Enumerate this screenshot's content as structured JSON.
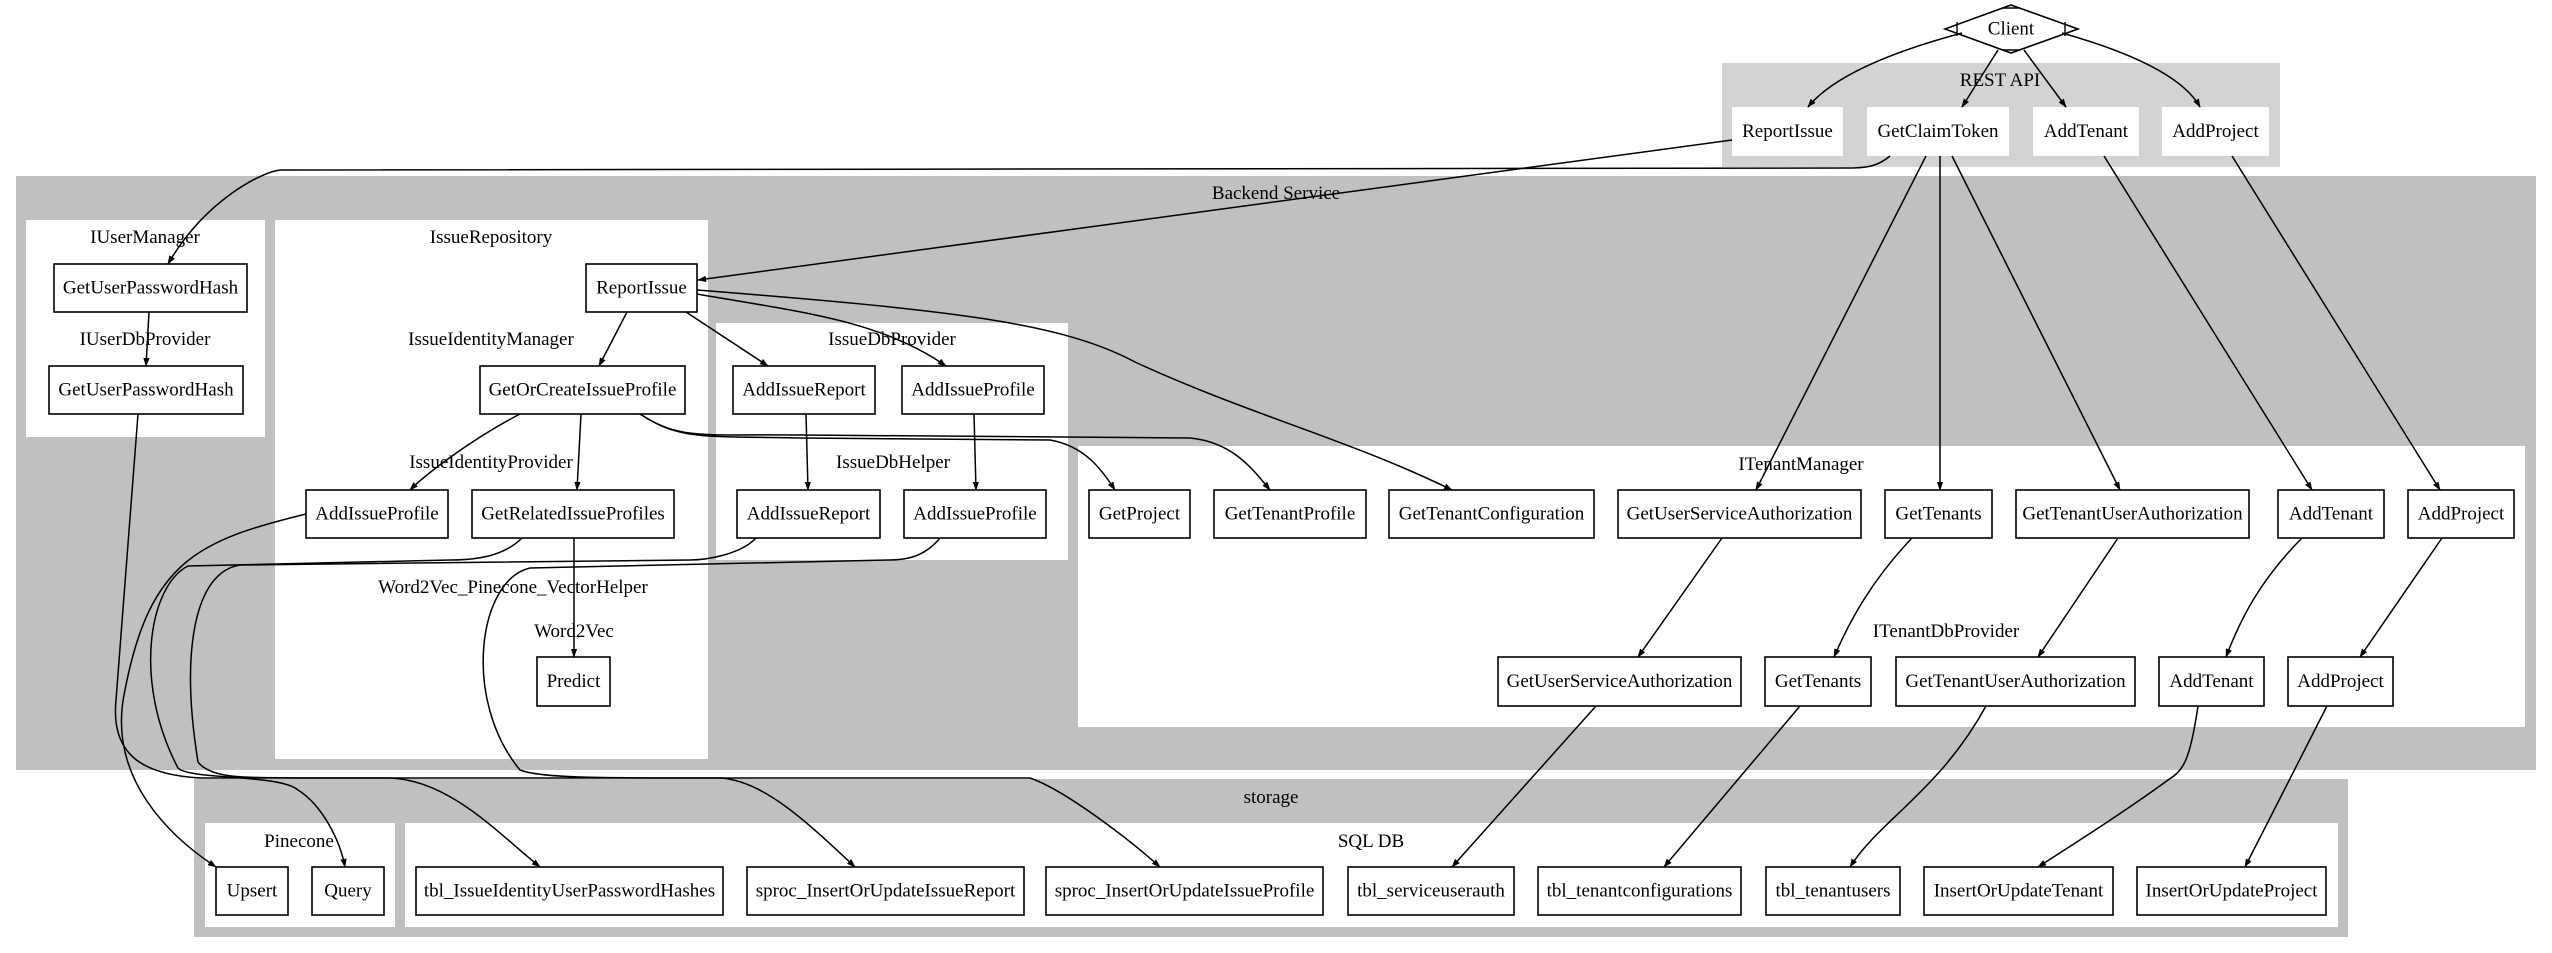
{
  "colors": {
    "rest_api_fill": "#d3d3d3",
    "outer_cluster_fill": "#c0c0c0",
    "inner_cluster_fill": "#ffffff",
    "node_stroke": "#000000"
  },
  "client": "Client",
  "clusters": {
    "rest_api": "REST API",
    "backend_service": "Backend Service",
    "iuser_manager": "IUserManager",
    "iuser_db_provider": "IUserDbProvider",
    "issue_repository": "IssueRepository",
    "issue_identity_manager": "IssueIdentityManager",
    "issue_identity_provider": "IssueIdentityProvider",
    "vector_helper": "Word2Vec_Pinecone_VectorHelper",
    "word2vec": "Word2Vec",
    "issue_db_provider": "IssueDbProvider",
    "issue_db_helper": "IssueDbHelper",
    "itenant_manager": "ITenantManager",
    "itenant_db_provider": "ITenantDbProvider",
    "storage": "storage",
    "pinecone": "Pinecone",
    "sql_db": "SQL DB"
  },
  "nodes": {
    "rest_report_issue": "ReportIssue",
    "rest_get_claim_token": "GetClaimToken",
    "rest_add_tenant": "AddTenant",
    "rest_add_project": "AddProject",
    "um_get_user_password_hash": "GetUserPasswordHash",
    "udb_get_user_password_hash": "GetUserPasswordHash",
    "repo_report_issue": "ReportIssue",
    "im_get_or_create_issue_profile": "GetOrCreateIssueProfile",
    "ip_add_issue_profile": "AddIssueProfile",
    "ip_get_related_issue_profiles": "GetRelatedIssueProfiles",
    "w2v_predict": "Predict",
    "dbp_add_issue_report": "AddIssueReport",
    "dbp_add_issue_profile": "AddIssueProfile",
    "dbh_add_issue_report": "AddIssueReport",
    "dbh_add_issue_profile": "AddIssueProfile",
    "tm_get_project": "GetProject",
    "tm_get_tenant_profile": "GetTenantProfile",
    "tm_get_tenant_configuration": "GetTenantConfiguration",
    "tm_get_user_service_authorization": "GetUserServiceAuthorization",
    "tm_get_tenants": "GetTenants",
    "tm_get_tenant_user_authorization": "GetTenantUserAuthorization",
    "tm_add_tenant": "AddTenant",
    "tm_add_project": "AddProject",
    "tdb_get_user_service_authorization": "GetUserServiceAuthorization",
    "tdb_get_tenants": "GetTenants",
    "tdb_get_tenant_user_authorization": "GetTenantUserAuthorization",
    "tdb_add_tenant": "AddTenant",
    "tdb_add_project": "AddProject",
    "pc_upsert": "Upsert",
    "pc_query": "Query",
    "sql_tbl_password_hashes": "tbl_IssueIdentityUserPasswordHashes",
    "sql_sproc_issue_report": "sproc_InsertOrUpdateIssueReport",
    "sql_sproc_issue_profile": "sproc_InsertOrUpdateIssueProfile",
    "sql_tbl_serviceuserauth": "tbl_serviceuserauth",
    "sql_tbl_tenantconfigurations": "tbl_tenantconfigurations",
    "sql_tbl_tenantusers": "tbl_tenantusers",
    "sql_insert_or_update_tenant": "InsertOrUpdateTenant",
    "sql_insert_or_update_project": "InsertOrUpdateProject"
  }
}
